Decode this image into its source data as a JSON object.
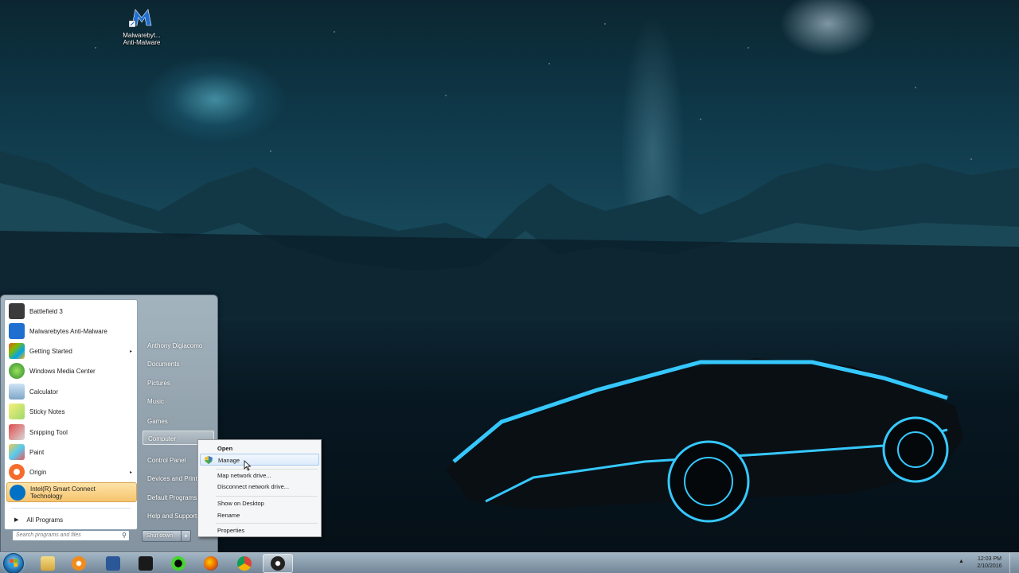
{
  "desktop": {
    "icons": [
      {
        "label_line1": "Malwarebyt...",
        "label_line2": "Anti-Malware",
        "icon": "malwarebytes-icon"
      }
    ]
  },
  "start_menu": {
    "programs": [
      {
        "label": "Battlefield 3",
        "icon": "battlefield-icon"
      },
      {
        "label": "Malwarebytes Anti-Malware",
        "icon": "malwarebytes-icon"
      },
      {
        "label": "Getting Started",
        "icon": "getting-started-icon",
        "submenu": "▸"
      },
      {
        "label": "Windows Media Center",
        "icon": "media-center-icon"
      },
      {
        "label": "Calculator",
        "icon": "calculator-icon"
      },
      {
        "label": "Sticky Notes",
        "icon": "sticky-notes-icon"
      },
      {
        "label": "Snipping Tool",
        "icon": "snipping-tool-icon"
      },
      {
        "label": "Paint",
        "icon": "paint-icon"
      },
      {
        "label": "Origin",
        "icon": "origin-icon",
        "submenu": "▸"
      },
      {
        "label_line1": "Intel(R) Smart Connect",
        "label_line2": "Technology",
        "icon": "intel-icon"
      }
    ],
    "all_programs": {
      "label": "All Programs",
      "arrow": "▶"
    },
    "search": {
      "placeholder": "Search programs and files",
      "icon": "⚲"
    },
    "right_items": [
      {
        "label": "Anthony Digiacomo"
      },
      {
        "label": "Documents"
      },
      {
        "label": "Pictures"
      },
      {
        "label": "Music"
      },
      {
        "label": "Games"
      },
      {
        "label": "Computer"
      },
      {
        "label": "Control Panel"
      },
      {
        "label": "Devices and Printers"
      },
      {
        "label": "Default Programs"
      },
      {
        "label": "Help and Support"
      }
    ],
    "shutdown": {
      "label": "Shut down",
      "arrow": "▸"
    }
  },
  "context_menu": {
    "items": [
      {
        "label": "Open"
      },
      {
        "label": "Manage"
      },
      {
        "label": "Map network drive..."
      },
      {
        "label": "Disconnect network drive..."
      },
      {
        "label": "Show on Desktop"
      },
      {
        "label": "Rename"
      },
      {
        "label": "Properties"
      }
    ]
  },
  "taskbar": {
    "pinned": [
      {
        "icon": "file-explorer-icon",
        "color": "#e8c660"
      },
      {
        "icon": "media-player-icon",
        "color": "#f28b1b"
      },
      {
        "icon": "word-icon",
        "color": "#2b5797"
      },
      {
        "icon": "game-app-icon",
        "color": "#1a1a1a"
      },
      {
        "icon": "razer-icon",
        "color": "#44d62c"
      },
      {
        "icon": "firefox-icon",
        "color": "#e66000"
      },
      {
        "icon": "chrome-icon",
        "color": "#4285f4"
      },
      {
        "icon": "obs-icon",
        "color": "#222222"
      }
    ],
    "tray_arrow": "▲",
    "clock": {
      "time": "12:03 PM",
      "date": "2/10/2016"
    }
  },
  "colors": {
    "accent_glow": "#35c8ff",
    "highlight": "#f6c46e"
  }
}
